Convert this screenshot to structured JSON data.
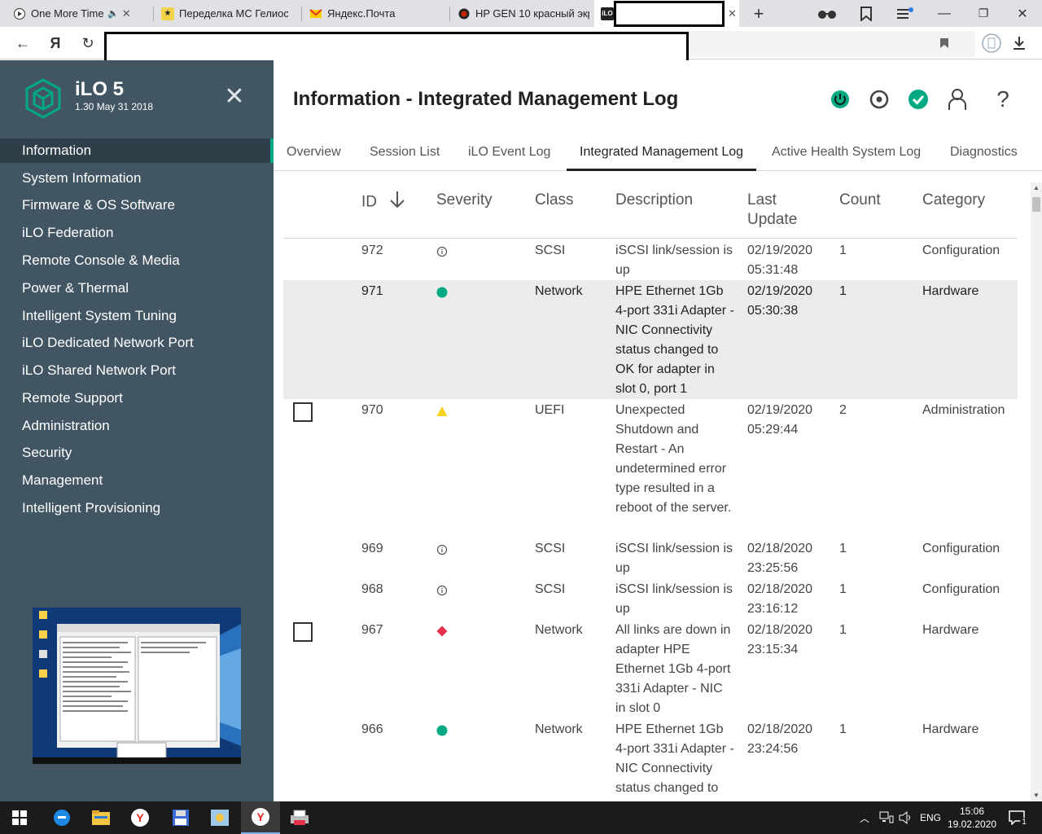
{
  "browser": {
    "tabs": [
      {
        "title": "One More Time –",
        "extra": "🔈",
        "favicon": "play-icon",
        "color": "#ffffff"
      },
      {
        "title": "Переделка МС Гелиос –",
        "favicon": "bookmark-icon",
        "color": "#f3d34a"
      },
      {
        "title": "Яндекс.Почта",
        "favicon": "mail-icon",
        "color": "#ff3333"
      },
      {
        "title": "HP GEN 10 красный экр",
        "favicon": "site-icon",
        "color": "#cc2200"
      },
      {
        "title": "",
        "favicon": "ilo-icon",
        "color": "#222222"
      }
    ],
    "new_tab_label": "+",
    "address_text": ""
  },
  "ilo": {
    "title": "iLO 5",
    "version": "1.30 May 31 2018",
    "nav": [
      {
        "label": "Information",
        "active": true
      },
      {
        "label": "System Information"
      },
      {
        "label": "Firmware & OS Software"
      },
      {
        "label": "iLO Federation"
      },
      {
        "label": "Remote Console & Media"
      },
      {
        "label": "Power & Thermal"
      },
      {
        "label": "Intelligent System Tuning"
      },
      {
        "label": "iLO Dedicated Network Port"
      },
      {
        "label": "iLO Shared Network Port"
      },
      {
        "label": "Remote Support"
      },
      {
        "label": "Administration"
      },
      {
        "label": "Security"
      },
      {
        "label": "Management"
      },
      {
        "label": "Intelligent Provisioning"
      }
    ],
    "colors": {
      "sidebar": "#425563",
      "accent": "#01a982",
      "warning": "#f7d21b",
      "critical": "#e5324b"
    }
  },
  "page": {
    "title": "Information - Integrated Management Log",
    "tabs": [
      "Overview",
      "Session List",
      "iLO Event Log",
      "Integrated Management Log",
      "Active Health System Log",
      "Diagnostics"
    ],
    "active_tab": "Integrated Management Log"
  },
  "table": {
    "columns": {
      "id": "ID",
      "severity": "Severity",
      "class": "Class",
      "description": "Description",
      "last_update": "Last Update",
      "count": "Count",
      "category": "Category"
    },
    "sort": "descending",
    "rows": [
      {
        "id": "972",
        "severity": "informational",
        "class": "SCSI",
        "description": "iSCSI link/session is up",
        "last_update": "02/19/2020 05:31:48",
        "count": "1",
        "category": "Configuration"
      },
      {
        "id": "971",
        "severity": "ok",
        "class": "Network",
        "description": "HPE Ethernet 1Gb 4-port 331i Adapter - NIC Connectivity status changed to OK for adapter in slot 0, port 1",
        "last_update": "02/19/2020 05:30:38",
        "count": "1",
        "category": "Hardware"
      },
      {
        "id": "970",
        "severity": "caution",
        "class": "UEFI",
        "description": "Unexpected Shutdown and Restart - An undetermined error type resulted in a reboot of the server.",
        "last_update": "02/19/2020 05:29:44",
        "count": "2",
        "category": "Administration"
      },
      {
        "id": "969",
        "severity": "informational",
        "class": "SCSI",
        "description": "iSCSI link/session is up",
        "last_update": "02/18/2020 23:25:56",
        "count": "1",
        "category": "Configuration"
      },
      {
        "id": "968",
        "severity": "informational",
        "class": "SCSI",
        "description": "iSCSI link/session is up",
        "last_update": "02/18/2020 23:16:12",
        "count": "1",
        "category": "Configuration"
      },
      {
        "id": "967",
        "severity": "critical",
        "class": "Network",
        "description": "All links are down in adapter HPE Ethernet 1Gb 4-port 331i Adapter - NIC in slot 0",
        "last_update": "02/18/2020 23:15:34",
        "count": "1",
        "category": "Hardware"
      },
      {
        "id": "966",
        "severity": "ok",
        "class": "Network",
        "description": "HPE Ethernet 1Gb 4-port 331i Adapter - NIC Connectivity status changed to",
        "last_update": "02/18/2020 23:24:56",
        "count": "1",
        "category": "Hardware"
      }
    ]
  },
  "taskbar": {
    "lang": "ENG",
    "time": "15:06",
    "date": "19.02.2020",
    "notifications": "1"
  }
}
